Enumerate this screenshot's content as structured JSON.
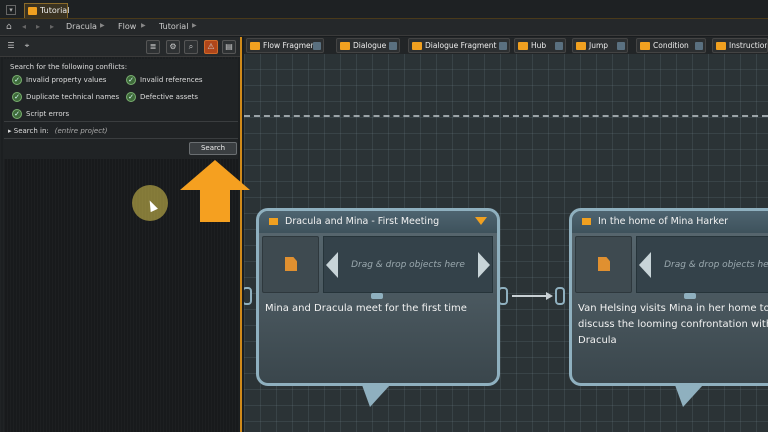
{
  "doc_tab": {
    "label": "Tutorial"
  },
  "breadcrumbs": [
    "Dracula",
    "Flow",
    "Tutorial"
  ],
  "conflicts": {
    "title": "Search for the following conflicts:",
    "options": [
      {
        "label": "Invalid property values",
        "checked": true
      },
      {
        "label": "Invalid references",
        "checked": true
      },
      {
        "label": "Duplicate technical names",
        "checked": true
      },
      {
        "label": "Defective assets",
        "checked": true
      },
      {
        "label": "Script errors",
        "checked": true
      }
    ],
    "search_in_label": "Search in:",
    "search_in_value": "(entire project)",
    "search_button": "Search"
  },
  "node_types": [
    {
      "label": "Flow Fragment",
      "icon": "flow-fragment-icon"
    },
    {
      "label": "Dialogue",
      "icon": "dialogue-icon"
    },
    {
      "label": "Dialogue Fragment",
      "icon": "dialogue-fragment-icon"
    },
    {
      "label": "Hub",
      "icon": "hub-icon"
    },
    {
      "label": "Jump",
      "icon": "jump-icon"
    },
    {
      "label": "Condition",
      "icon": "condition-icon"
    },
    {
      "label": "Instruction",
      "icon": "instruction-icon"
    }
  ],
  "nodes": [
    {
      "title": "Dracula and Mina - First Meeting",
      "drop_hint": "Drag & drop objects here",
      "text": "Mina and Dracula meet for the first time"
    },
    {
      "title": "In the home of Mina Harker",
      "drop_hint": "Drag & drop objects here",
      "text": "Van Helsing visits Mina in her home to discuss the looming confrontation with Dracula"
    }
  ],
  "colors": {
    "accent": "#f0a020",
    "node_border": "#8fb0bf",
    "canvas_bg": "#2b3336"
  }
}
